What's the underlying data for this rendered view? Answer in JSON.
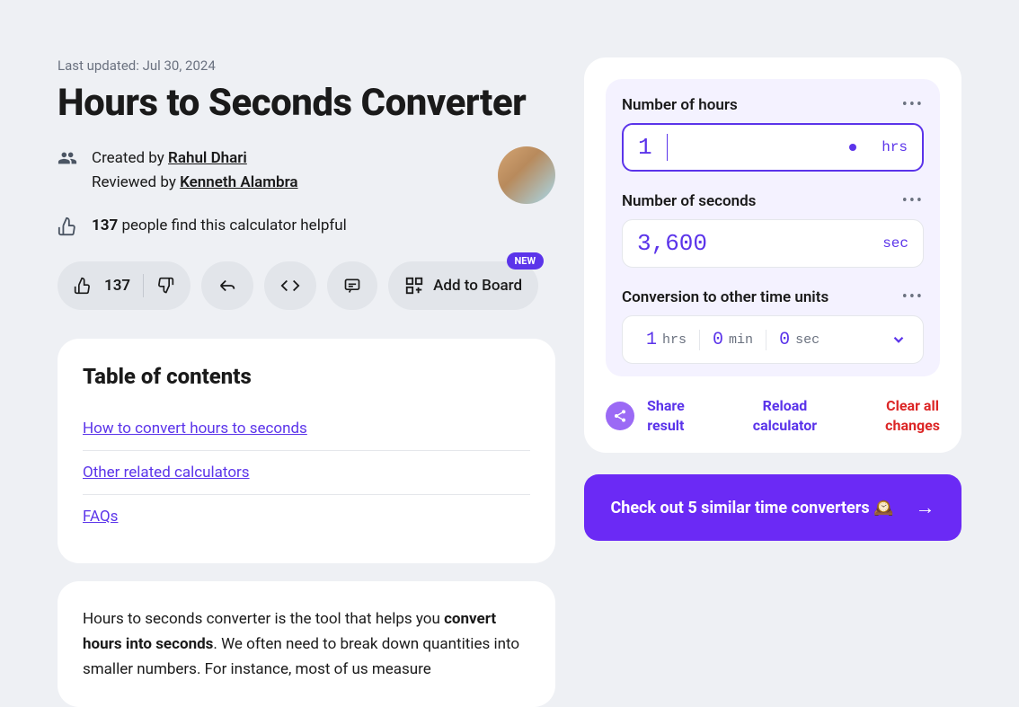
{
  "header": {
    "last_updated": "Last updated: Jul 30, 2024",
    "title": "Hours to Seconds Converter",
    "created_by_label": "Created by ",
    "created_by_name": "Rahul Dhari",
    "reviewed_by_label": "Reviewed by ",
    "reviewed_by_name": "Kenneth Alambra",
    "helpful_count": "137",
    "helpful_text": " people find this calculator helpful"
  },
  "actions": {
    "vote_count": "137",
    "add_to_board": "Add to Board",
    "new_badge": "NEW"
  },
  "toc": {
    "title": "Table of contents",
    "items": [
      "How to convert hours to seconds",
      "Other related calculators",
      "FAQs"
    ]
  },
  "body": {
    "intro_pre": "Hours to seconds converter is the tool that helps you ",
    "intro_bold": "convert hours into seconds",
    "intro_post": ". We often need to break down quantities into smaller numbers. For instance, most of us measure"
  },
  "calc": {
    "hours_label": "Number of hours",
    "hours_value": "1",
    "hours_unit": "hrs",
    "seconds_label": "Number of seconds",
    "seconds_value": "3,600",
    "seconds_unit": "sec",
    "other_label": "Conversion to other time units",
    "hms": {
      "h": "1",
      "h_unit": "hrs",
      "m": "0",
      "m_unit": "min",
      "s": "0",
      "s_unit": "sec"
    },
    "share_label": "Share result",
    "reload_label": "Reload calculator",
    "clear_label": "Clear all changes"
  },
  "promo": {
    "text": "Check out 5 similar time converters 🕰️"
  }
}
